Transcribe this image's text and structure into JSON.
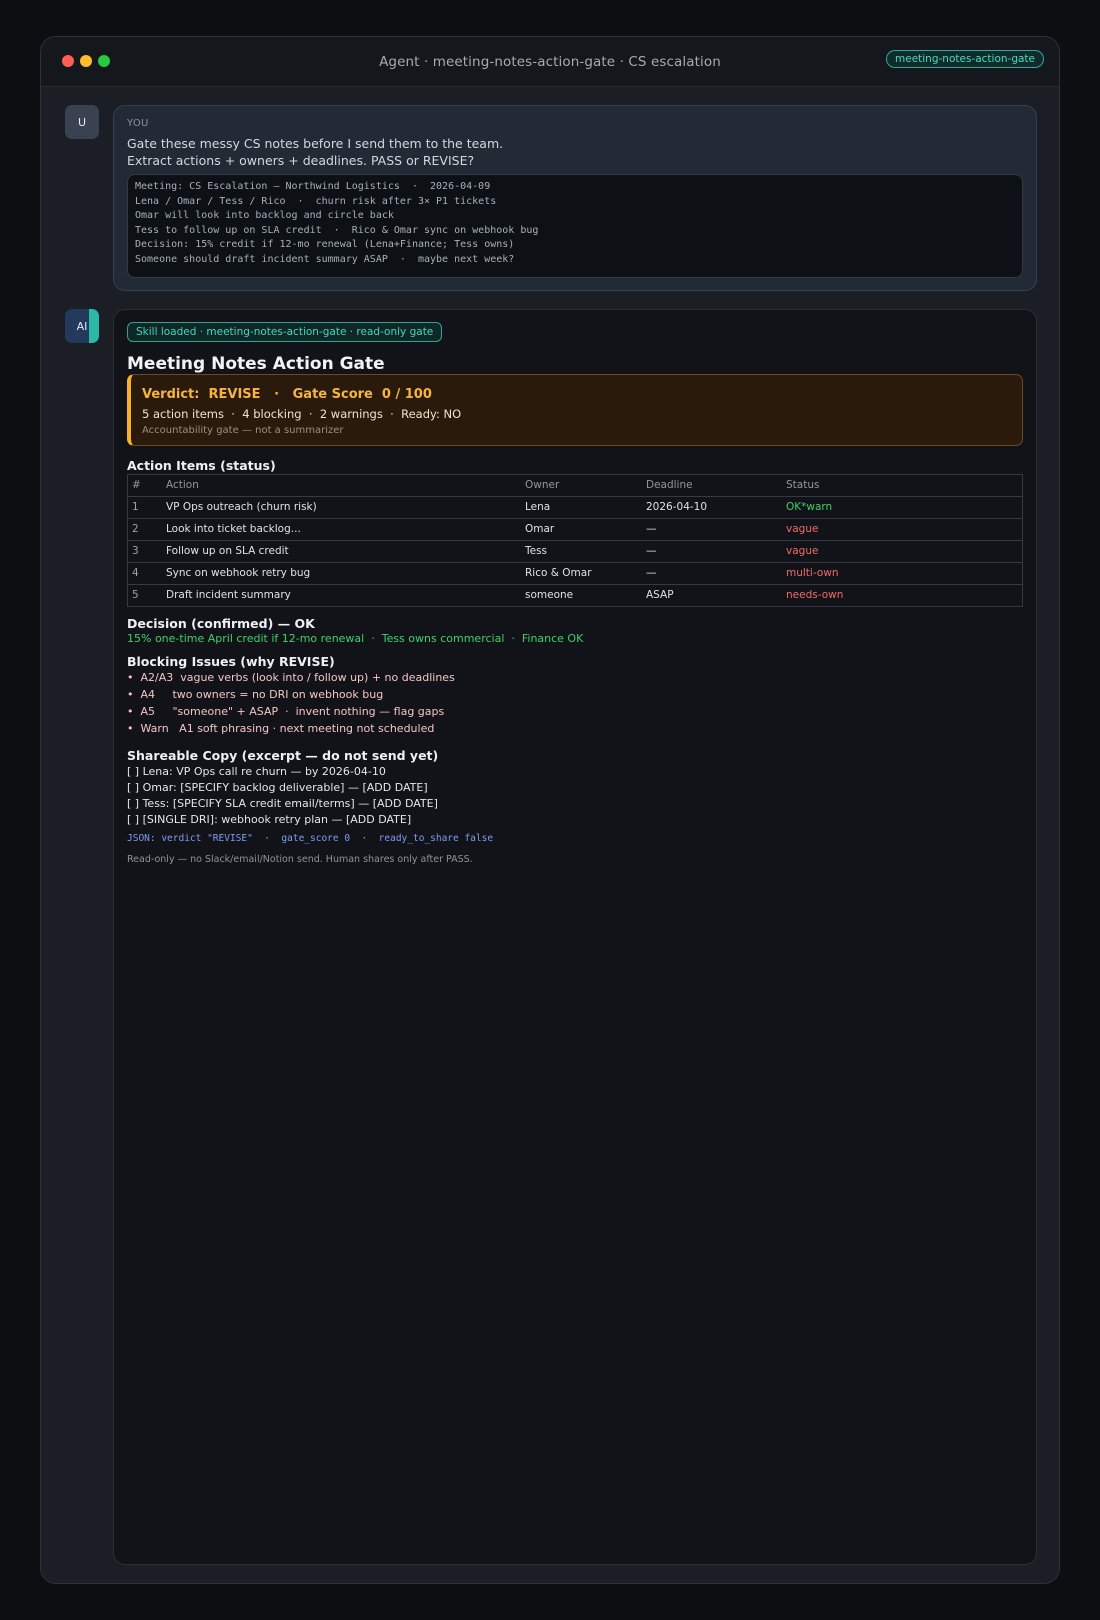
{
  "window": {
    "title": "Agent  ·  meeting-notes-action-gate  ·  CS escalation",
    "pill": "meeting-notes-action-gate"
  },
  "user": {
    "avatar": "U",
    "label": "YOU",
    "line1": "Gate these messy CS notes before I send them to the team.",
    "line2": "Extract actions + owners + deadlines. PASS or REVISE?",
    "notes": [
      "Meeting: CS Escalation — Northwind Logistics  ·  2026-04-09",
      "Lena / Omar / Tess / Rico  ·  churn risk after 3× P1 tickets",
      "Omar will look into backlog and circle back",
      "Tess to follow up on SLA credit  ·  Rico & Omar sync on webhook bug",
      "Decision: 15% credit if 12-mo renewal (Lena+Finance; Tess owns)",
      "Someone should draft incident summary ASAP  ·  maybe next week?"
    ]
  },
  "ai": {
    "avatar": "AI",
    "skill_badge": "Skill loaded  ·  meeting-notes-action-gate  ·  read-only gate",
    "title": "Meeting Notes Action Gate",
    "verdict_line": "Verdict:  REVISE   ·   Gate Score  0 / 100",
    "verdict_sub": "5 action items  ·  4 blocking  ·  2 warnings  ·  Ready: NO",
    "verdict_note": "Accountability gate — not a summarizer",
    "colors": {
      "accent": "#f5b22a",
      "ok": "#3fcf6b",
      "bad": "#f06a6a",
      "teal": "#45d6bf"
    },
    "action_heading": "Action Items (status)",
    "table": {
      "headers": [
        "#",
        "Action",
        "Owner",
        "Deadline",
        "Status"
      ],
      "rows": [
        {
          "num": "1",
          "action": "VP Ops outreach (churn risk)",
          "owner": "Lena",
          "deadline": "2026-04-10",
          "status": "OK*warn"
        },
        {
          "num": "2",
          "action": "Look into ticket backlog...",
          "owner": "Omar",
          "deadline": "—",
          "status": "vague"
        },
        {
          "num": "3",
          "action": "Follow up on SLA credit",
          "owner": "Tess",
          "deadline": "—",
          "status": "vague"
        },
        {
          "num": "4",
          "action": "Sync on webhook retry bug",
          "owner": "Rico & Omar",
          "deadline": "—",
          "status": "multi-own"
        },
        {
          "num": "5",
          "action": "Draft incident summary",
          "owner": "someone",
          "deadline": "ASAP",
          "status": "needs-own"
        }
      ]
    },
    "decision_heading": "Decision (confirmed) — OK",
    "decision_text": "15% one-time April credit if 12-mo renewal  ·  Tess owns commercial  ·  Finance OK",
    "blocking_heading": "Blocking Issues (why REVISE)",
    "blocking": [
      "•  A2/A3  vague verbs (look into / follow up) + no deadlines",
      "•  A4     two owners = no DRI on webhook bug",
      "•  A5     \"someone\" + ASAP  ·  invent nothing — flag gaps",
      "•  Warn   A1 soft phrasing · next meeting not scheduled"
    ],
    "copy_heading": "Shareable Copy (excerpt — do not send yet)",
    "copy_lines": [
      "[ ] Lena: VP Ops call re churn — by 2026-04-10",
      "[ ] Omar: [SPECIFY backlog deliverable] — [ADD DATE]",
      "[ ] Tess: [SPECIFY SLA credit email/terms] — [ADD DATE]",
      "[ ] [SINGLE DRI]: webhook retry plan — [ADD DATE]"
    ],
    "json_line": "JSON: verdict \"REVISE\"  ·  gate_score 0  ·  ready_to_share false",
    "footer": "Read-only — no Slack/email/Notion send. Human shares only after PASS."
  }
}
